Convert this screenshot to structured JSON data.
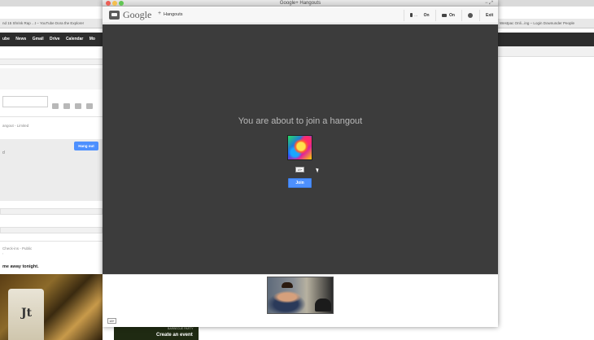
{
  "background_page": {
    "bookmarks_left": "nd 15   Shrink Rap ...t – YouTube   Dora the Explorer",
    "nav_items": [
      "ube",
      "News",
      "Gmail",
      "Drive",
      "Calendar",
      "Mo"
    ],
    "post1_meta": "angout  -  Limited",
    "hangout_button": "Hang out",
    "box_text": "d",
    "checkin_meta": "Check-ins  -  Public",
    "checkin_punct": ",",
    "post_text": "me away tonight.",
    "event_small": "BARBECUE PARTY",
    "event_title": "Create an event",
    "bookmarks_right": "Westpac Onli...ing – Login   Downunder People"
  },
  "window": {
    "title": "Google+ Hangouts",
    "title_controls": "−  ⤢"
  },
  "toolbar": {
    "brand": "Google",
    "brand_plus": "+",
    "brand_sub": "Hangouts",
    "mic_label": "On",
    "mic_dots": "...",
    "camera_label": "On",
    "exit_label": "Exit"
  },
  "stage": {
    "heading": "You are about to join a hangout",
    "age_badge": "18+",
    "join_button": "Join"
  },
  "filmstrip": {
    "age_badge": "18+"
  }
}
